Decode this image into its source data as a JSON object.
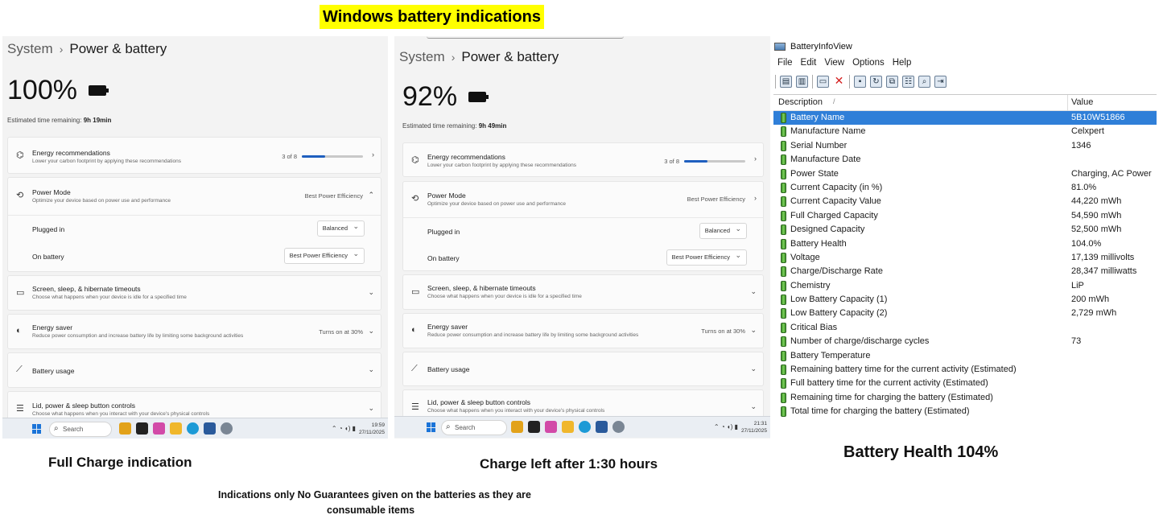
{
  "page_title": "Windows battery indications",
  "panels": [
    {
      "breadcrumb_system": "System",
      "breadcrumb_page": "Power & battery",
      "percent": "100%",
      "est_label": "Estimated time remaining:",
      "est_value": "9h 19min",
      "energy_title": "Energy recommendations",
      "energy_sub": "Lower your carbon footprint by applying these recommendations",
      "energy_count": "3 of 8",
      "energy_progress": 0.375,
      "power_mode_title": "Power Mode",
      "power_mode_sub": "Optimize your device based on power use and performance",
      "power_mode_value": "Best Power Efficiency",
      "plugged_in_label": "Plugged in",
      "plugged_in_value": "Balanced",
      "on_battery_label": "On battery",
      "on_battery_value": "Best Power Efficiency",
      "screen_title": "Screen, sleep, & hibernate timeouts",
      "screen_sub": "Choose what happens when your device is idle for a specified time",
      "saver_title": "Energy saver",
      "saver_sub": "Reduce power consumption and increase battery life by limiting some background activities",
      "saver_value": "Turns on at 30%",
      "usage_title": "Battery usage",
      "lid_title": "Lid, power & sleep button controls",
      "lid_sub": "Choose what happens when you interact with your device's physical controls",
      "search": "Search",
      "time": "19:59",
      "date": "27/11/2025",
      "caption": "Full Charge indication"
    },
    {
      "breadcrumb_system": "System",
      "breadcrumb_page": "Power & battery",
      "percent": "92%",
      "est_label": "Estimated time remaining:",
      "est_value": "9h 49min",
      "energy_title": "Energy recommendations",
      "energy_sub": "Lower your carbon footprint by applying these recommendations",
      "energy_count": "3 of 8",
      "energy_progress": 0.375,
      "power_mode_title": "Power Mode",
      "power_mode_sub": "Optimize your device based on power use and performance",
      "power_mode_value": "Best Power Efficiency",
      "plugged_in_label": "Plugged in",
      "plugged_in_value": "Balanced",
      "on_battery_label": "On battery",
      "on_battery_value": "Best Power Efficiency",
      "screen_title": "Screen, sleep, & hibernate timeouts",
      "screen_sub": "Choose what happens when your device is idle for a specified time",
      "saver_title": "Energy saver",
      "saver_sub": "Reduce power consumption and increase battery life by limiting some background activities",
      "saver_value": "Turns on at 30%",
      "usage_title": "Battery usage",
      "lid_title": "Lid, power & sleep button controls",
      "lid_sub": "Choose what happens when you interact with your device's physical controls",
      "search": "Search",
      "time": "21:31",
      "date": "27/11/2025",
      "caption": "Charge left after 1:30 hours"
    }
  ],
  "biv": {
    "title": "BatteryInfoView",
    "menu": [
      "File",
      "Edit",
      "View",
      "Options",
      "Help"
    ],
    "col_description": "Description",
    "col_value": "Value",
    "rows": [
      {
        "desc": "Battery Name",
        "val": "5B10W51866"
      },
      {
        "desc": "Manufacture Name",
        "val": "Celxpert"
      },
      {
        "desc": "Serial Number",
        "val": "1346"
      },
      {
        "desc": "Manufacture Date",
        "val": ""
      },
      {
        "desc": "Power State",
        "val": "Charging, AC Power"
      },
      {
        "desc": "Current Capacity (in %)",
        "val": "81.0%"
      },
      {
        "desc": "Current Capacity Value",
        "val": "44,220 mWh"
      },
      {
        "desc": "Full Charged Capacity",
        "val": "54,590 mWh"
      },
      {
        "desc": "Designed Capacity",
        "val": "52,500 mWh"
      },
      {
        "desc": "Battery Health",
        "val": "104.0%"
      },
      {
        "desc": "Voltage",
        "val": "17,139 millivolts"
      },
      {
        "desc": "Charge/Discharge Rate",
        "val": "28,347 milliwatts"
      },
      {
        "desc": "Chemistry",
        "val": "LiP"
      },
      {
        "desc": "Low Battery Capacity (1)",
        "val": "200 mWh"
      },
      {
        "desc": "Low Battery Capacity (2)",
        "val": "2,729 mWh"
      },
      {
        "desc": "Critical Bias",
        "val": ""
      },
      {
        "desc": "Number of charge/discharge cycles",
        "val": "73"
      },
      {
        "desc": "Battery Temperature",
        "val": ""
      },
      {
        "desc": "Remaining battery time for the current activity (Estimated)",
        "val": ""
      },
      {
        "desc": "Full battery time for the current activity (Estimated)",
        "val": ""
      },
      {
        "desc": "Remaining time for charging the battery (Estimated)",
        "val": ""
      },
      {
        "desc": "Total  time for charging the battery (Estimated)",
        "val": ""
      }
    ],
    "caption": "Battery Health 104%"
  },
  "footnote_line1": "Indications only No Guarantees given on the batteries as they are",
  "footnote_line2": "consumable items",
  "colors": {
    "highlight": "#ffff00",
    "selection": "#2f7fd8",
    "progress": "#1f5fbf"
  }
}
